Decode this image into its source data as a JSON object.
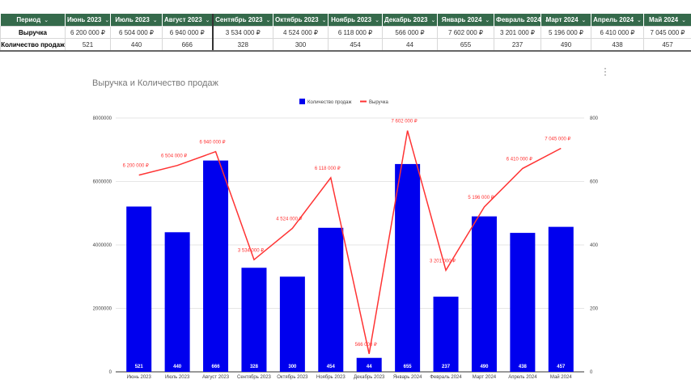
{
  "table": {
    "header": "Период",
    "months": [
      "Июнь 2023",
      "Июль 2023",
      "Август 2023",
      "Сентябрь 2023",
      "Октябрь 2023",
      "Ноябрь 2023",
      "Декабрь 2023",
      "Январь 2024",
      "Февраль 2024",
      "Март 2024",
      "Апрель 2024",
      "Май 2024"
    ],
    "rows": [
      {
        "label": "Выручка",
        "values": [
          "6 200 000 ₽",
          "6 504 000 ₽",
          "6 940 000 ₽",
          "3 534 000 ₽",
          "4 524 000 ₽",
          "6 118 000 ₽",
          "566 000 ₽",
          "7 602 000 ₽",
          "3 201 000 ₽",
          "5 196 000 ₽",
          "6 410 000 ₽",
          "7 045 000 ₽"
        ]
      },
      {
        "label": "Количество продаж",
        "values": [
          "521",
          "440",
          "666",
          "328",
          "300",
          "454",
          "44",
          "655",
          "237",
          "490",
          "438",
          "457"
        ]
      }
    ]
  },
  "chart_data": {
    "type": "bar+line",
    "title": "Выручка и Количество продаж",
    "categories": [
      "Июнь 2023",
      "Июль 2023",
      "Август 2023",
      "Сентябрь 2023",
      "Октябрь 2023",
      "Ноябрь 2023",
      "Декабрь 2023",
      "Январь 2024",
      "Февраль 2024",
      "Март 2024",
      "Апрель 2024",
      "Май 2024"
    ],
    "series": [
      {
        "name": "Количество продаж",
        "type": "bar",
        "axis": "right",
        "color": "#0000ee",
        "values": [
          521,
          440,
          666,
          328,
          300,
          454,
          44,
          655,
          237,
          490,
          438,
          457
        ]
      },
      {
        "name": "Выручка",
        "type": "line",
        "axis": "left",
        "color": "#ff3333",
        "values": [
          6200000,
          6504000,
          6940000,
          3534000,
          4524000,
          6118000,
          566000,
          7602000,
          3201000,
          5196000,
          6410000,
          7045000
        ],
        "labels": [
          "6 200 000 ₽",
          "6 504 000 ₽",
          "6 940 000 ₽",
          "3 534 000 ₽",
          "4 524 000 ₽",
          "6 118 000 ₽",
          "566 000 ₽",
          "7 602 000 ₽",
          "3 201 000 ₽",
          "5 196 000 ₽",
          "6 410 000 ₽",
          "7 045 000 ₽"
        ]
      }
    ],
    "left_axis": {
      "range": [
        0,
        8000000
      ],
      "ticks": [
        "0",
        "2000000",
        "4000000",
        "6000000",
        "8000000"
      ]
    },
    "right_axis": {
      "range": [
        0,
        800
      ],
      "ticks": [
        "0",
        "200",
        "400",
        "600",
        "800"
      ]
    },
    "legend": "top-center",
    "grid": true
  }
}
